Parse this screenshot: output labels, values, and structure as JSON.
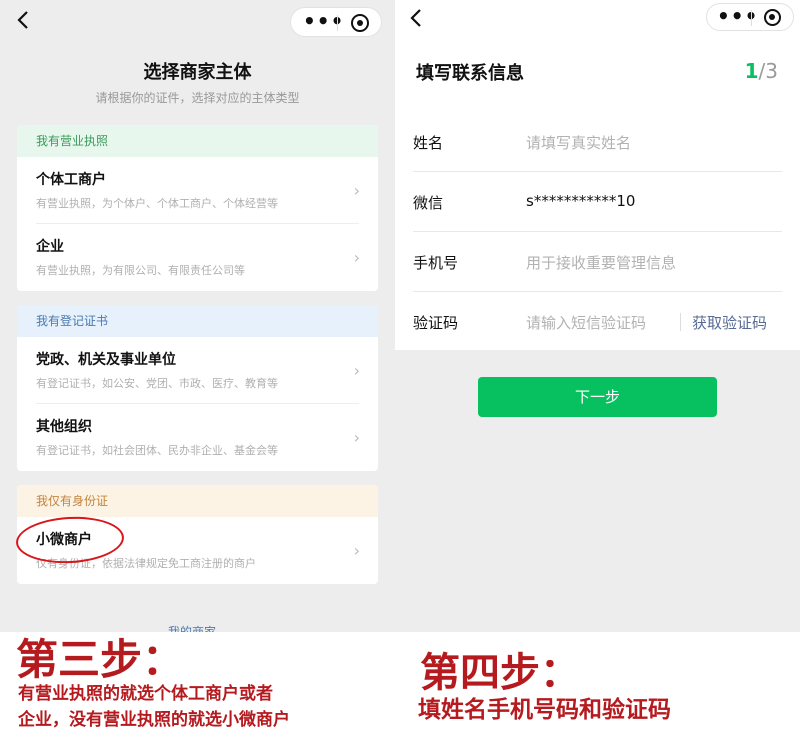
{
  "left_screen": {
    "title": "选择商家主体",
    "subtitle": "请根据你的证件，选择对应的主体类型",
    "sections": [
      {
        "header": "我有营业执照",
        "items": [
          {
            "title": "个体工商户",
            "desc": "有营业执照，为个体户、个体工商户、个体经营等"
          },
          {
            "title": "企业",
            "desc": "有营业执照，为有限公司、有限责任公司等"
          }
        ]
      },
      {
        "header": "我有登记证书",
        "items": [
          {
            "title": "党政、机关及事业单位",
            "desc": "有登记证书，如公安、党团、市政、医疗、教育等"
          },
          {
            "title": "其他组织",
            "desc": "有登记证书，如社会团体、民办非企业、基金会等"
          }
        ]
      },
      {
        "header": "我仅有身份证",
        "items": [
          {
            "title": "小微商户",
            "desc": "仅有身份证，依据法律规定免工商注册的商户"
          }
        ]
      }
    ],
    "footer_link": "我的商家",
    "chevron": "›"
  },
  "right_screen": {
    "title": "填写联系信息",
    "step_current": "1",
    "step_total": "/3",
    "fields": [
      {
        "label": "姓名",
        "value": "",
        "placeholder": "请填写真实姓名"
      },
      {
        "label": "微信",
        "value": "s***********10",
        "placeholder": ""
      },
      {
        "label": "手机号",
        "value": "",
        "placeholder": "用于接收重要管理信息"
      },
      {
        "label": "验证码",
        "value": "",
        "placeholder": "请输入短信验证码"
      }
    ],
    "get_code_label": "获取验证码",
    "next_button": "下一步"
  },
  "captions": {
    "step3_title": "第三步：",
    "step3_line1": "有营业执照的就选个体工商户或者",
    "step3_line2": "企业，没有营业执照的就选小微商户",
    "step4_title": "第四步：",
    "step4_line1": "填姓名手机号码和验证码"
  },
  "colors": {
    "accent_green": "#07c160",
    "link_blue": "#576b95",
    "caption_red": "#b51a1f",
    "highlight_red": "#d8161b"
  },
  "icons": {
    "back": "chevron-left-icon",
    "more": "more-dots-icon",
    "close": "target-circle-icon"
  }
}
